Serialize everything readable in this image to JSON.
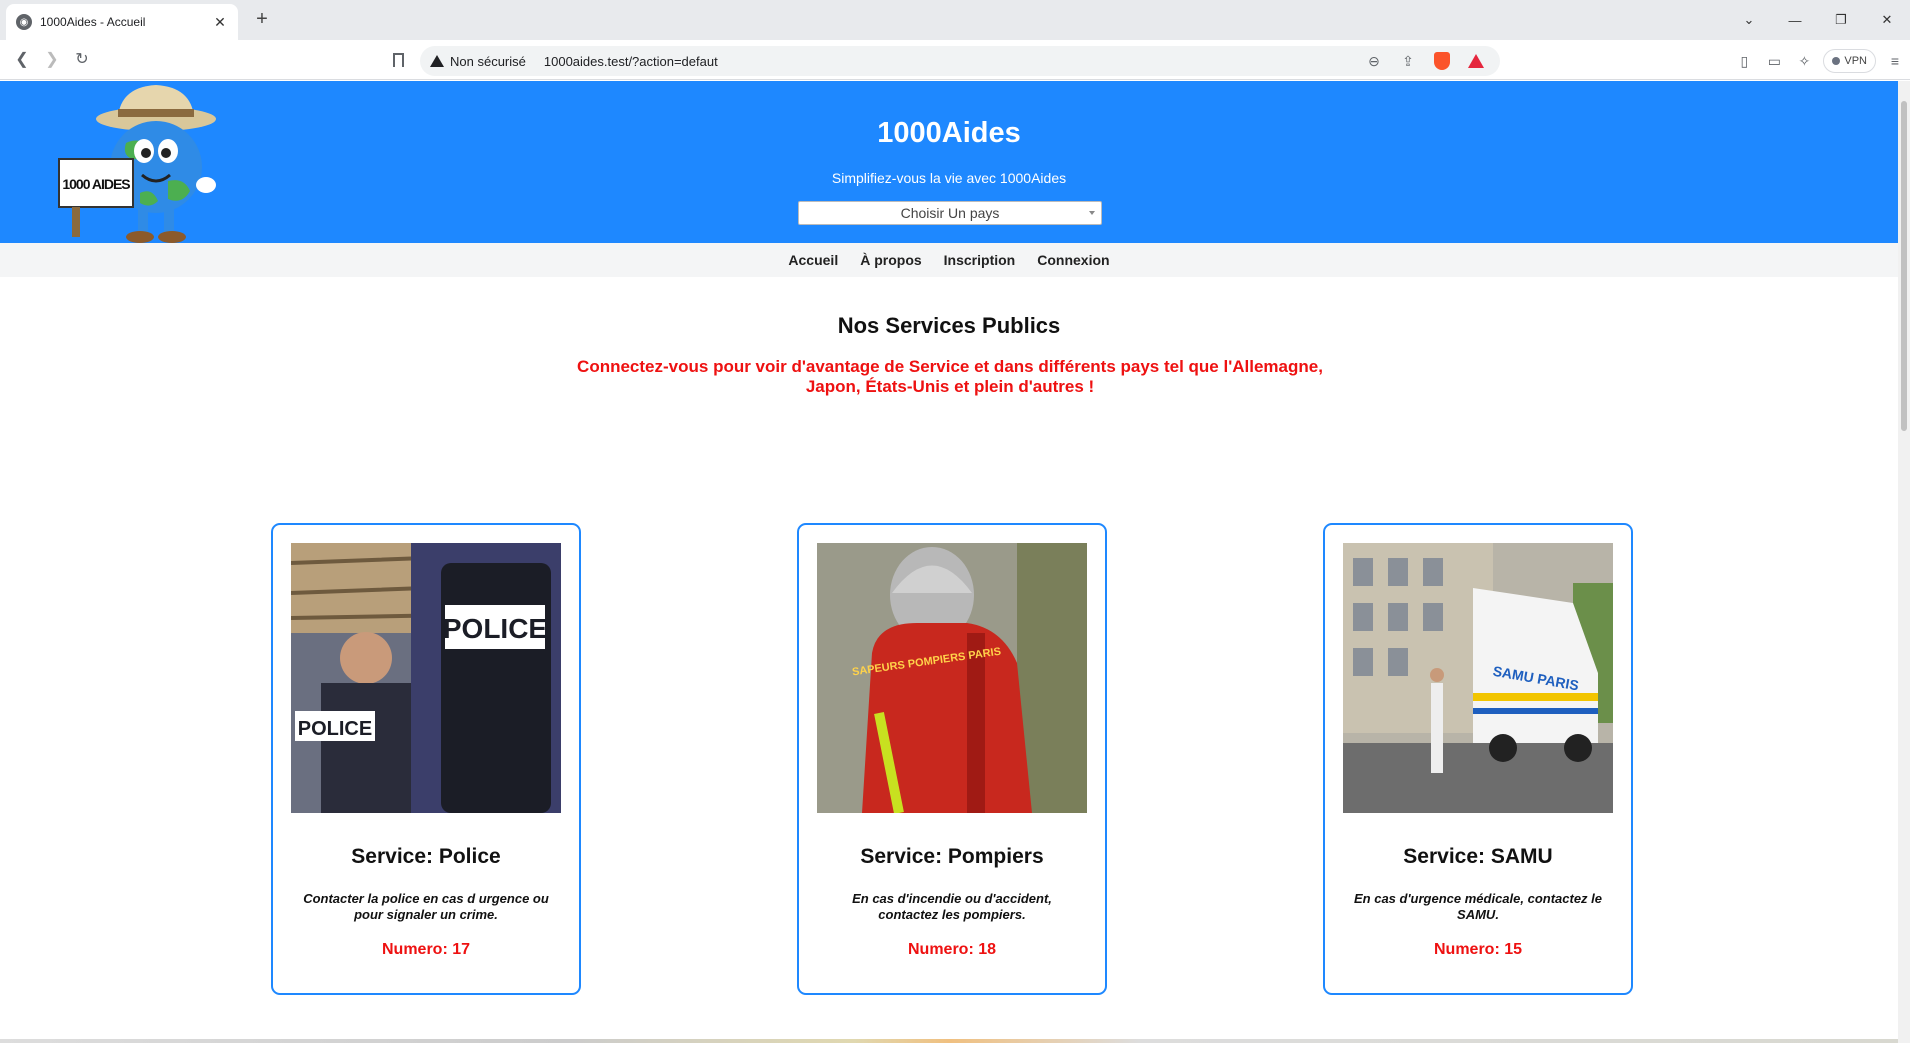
{
  "browser": {
    "tab_title": "1000Aides - Accueil",
    "security_label": "Non sécurisé",
    "url": "1000aides.test/?action=defaut",
    "vpn_label": "VPN"
  },
  "header": {
    "title": "1000Aides",
    "subtitle": "Simplifiez-vous la vie avec 1000Aides",
    "country_select": "Choisir Un pays",
    "logo_text": "1000 AIDES",
    "background_color": "#1e88ff"
  },
  "nav": {
    "items": [
      "Accueil",
      "À propos",
      "Inscription",
      "Connexion"
    ]
  },
  "main": {
    "title": "Nos Services Publics",
    "notice": "Connectez-vous pour voir d'avantage de Service et dans différents pays tel que l'Allemagne, Japon, États-Unis et plein d'autres !"
  },
  "services": [
    {
      "title": "Service: Police",
      "description": "Contacter la police en cas d urgence ou pour signaler un crime.",
      "number": "Numero: 17",
      "image_text": "POLICE"
    },
    {
      "title": "Service: Pompiers",
      "description": "En cas d'incendie ou d'accident, contactez les pompiers.",
      "number": "Numero: 18",
      "image_text": "SAPEURS POMPIERS PARIS"
    },
    {
      "title": "Service: SAMU",
      "description": "En cas d'urgence médicale, contactez le SAMU.",
      "number": "Numero: 15",
      "image_text": "SAMU PARIS"
    }
  ],
  "colors": {
    "accent": "#1e88ff",
    "alert": "#ee1111"
  }
}
